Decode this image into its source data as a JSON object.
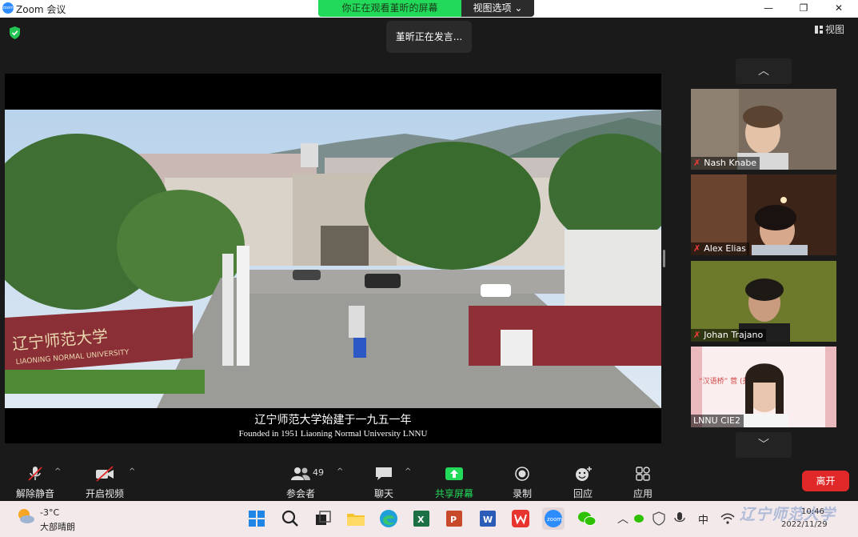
{
  "window": {
    "title": "Zoom 会议",
    "logo_text": "zoom",
    "minimize_glyph": "—",
    "maximize_glyph": "❐",
    "close_glyph": "✕"
  },
  "share_banner": {
    "watching_text": "你正在观看堇昕的屏幕",
    "view_options_label": "视图选项",
    "chevron_glyph": "⌄"
  },
  "speaking_toast": "堇昕正在发言...",
  "view_toggle_label": "视图",
  "shared_screen": {
    "caption_cn": "辽宁师范大学始建于一九五一年",
    "caption_en": "Founded in 1951  Liaoning Normal University  LNNU",
    "gate_text": "辽宁师范大学",
    "gate_text_en": "LIAONING NORMAL UNIVERSITY"
  },
  "gallery": {
    "up_arrow": "︿",
    "down_arrow": "﹀",
    "participants": [
      {
        "name": "Nash Knabe",
        "muted": true
      },
      {
        "name": "Alex Elias",
        "muted": true
      },
      {
        "name": "Johan Trajano",
        "muted": true
      },
      {
        "name": "LNNU CIE2",
        "muted": false,
        "slide_text": "“汉语桥” 营 (美国营)"
      }
    ]
  },
  "toolbar": {
    "unmute": "解除静音",
    "start_video": "开启视频",
    "participants": "参会者",
    "participant_count": "49",
    "chat": "聊天",
    "share_screen": "共享屏幕",
    "record": "录制",
    "reactions": "回应",
    "apps": "应用",
    "leave": "离开",
    "caret": "^"
  },
  "taskbar": {
    "temperature": "-3°C",
    "weather": "大部晴朗",
    "ime": "中",
    "time": "10:46",
    "date": "2022/11/29",
    "watermark": "辽宁师范大学",
    "tray_chevron": "︿"
  },
  "colors": {
    "zoom_blue": "#2d8cff",
    "banner_green": "#23d959",
    "leave_red": "#e02828",
    "share_green": "#23d959",
    "taskbar_bg": "#f3e9ea"
  }
}
